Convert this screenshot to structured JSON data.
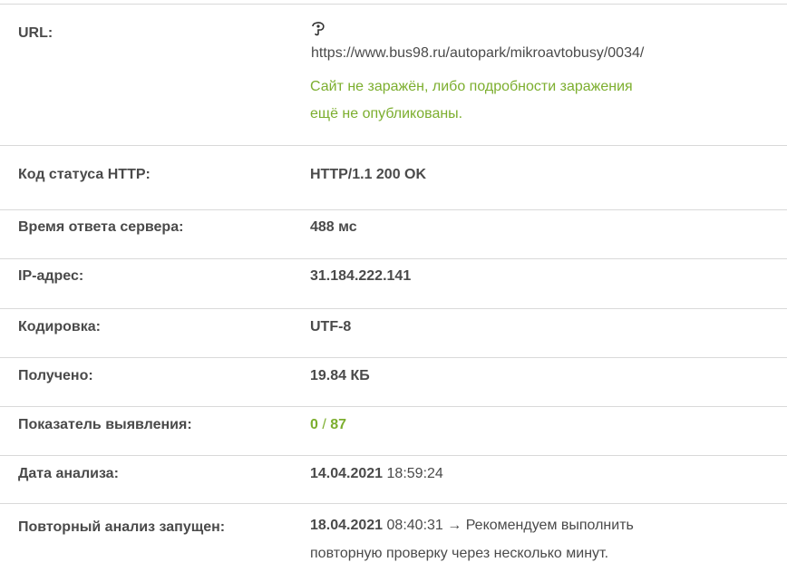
{
  "url_row": {
    "label": "URL:",
    "url": "https://www.bus98.ru/autopark/mikroavtobusy/0034/",
    "status_line1": "Сайт не заражён, либо подробности заражения",
    "status_line2": "ещё не опубликованы.",
    "icon": "link-icon"
  },
  "http_status": {
    "label": "Код статуса HTTP:",
    "value": "HTTP/1.1 200 OK"
  },
  "response_time": {
    "label": "Время ответа сервера:",
    "value": "488 мс"
  },
  "ip": {
    "label": "IP-адрес:",
    "value": "31.184.222.141"
  },
  "encoding": {
    "label": "Кодировка:",
    "value": "UTF-8"
  },
  "received": {
    "label": "Получено:",
    "value": "19.84 КБ"
  },
  "detection": {
    "label": "Показатель выявления:",
    "detected": "0",
    "separator": " / ",
    "total": "87"
  },
  "analysis_date": {
    "label": "Дата анализа:",
    "date": "14.04.2021",
    "time": " 18:59:24"
  },
  "rescan": {
    "label": "Повторный анализ запущен:",
    "date": "18.04.2021",
    "time": " 08:40:31",
    "note_line1": " → Рекомендуем выполнить",
    "note_line2": "повторную проверку через несколько минут."
  },
  "colors": {
    "accent_green": "#7cae2e",
    "text": "#4a4a4a",
    "border": "#d9d9d9"
  }
}
